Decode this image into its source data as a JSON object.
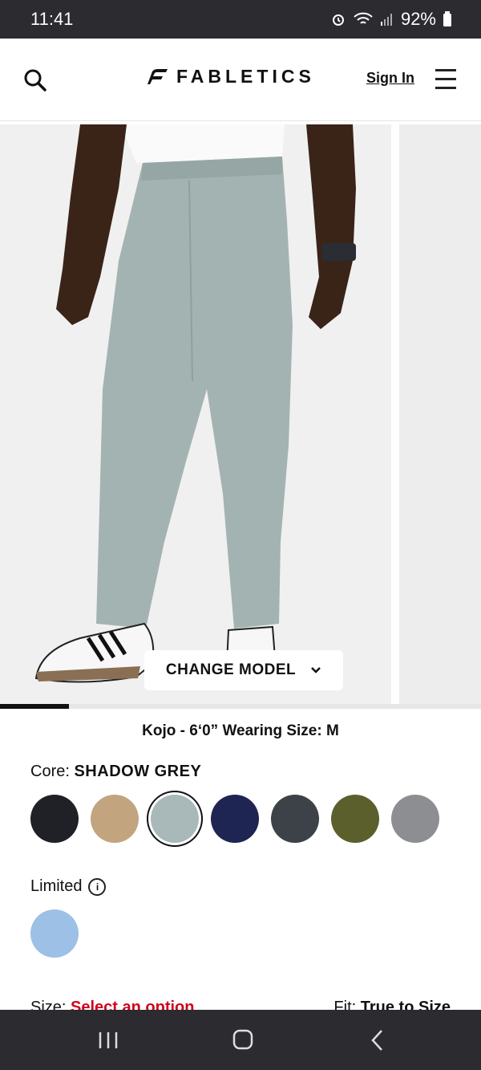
{
  "status_bar": {
    "time": "11:41",
    "battery": "92%"
  },
  "header": {
    "brand": "FABLETICS",
    "sign_in": "Sign In"
  },
  "gallery": {
    "change_model": "CHANGE MODEL",
    "progress": 0.143
  },
  "model_info": "Kojo - 6‘0” Wearing Size: M",
  "color": {
    "label": "Core:",
    "selected_name": "SHADOW GREY",
    "swatches": [
      {
        "name": "black",
        "color": "#1f2126"
      },
      {
        "name": "khaki",
        "color": "#c2a47f"
      },
      {
        "name": "shadow-grey",
        "color": "#a9b9b9",
        "selected": true
      },
      {
        "name": "navy",
        "color": "#1e2552"
      },
      {
        "name": "charcoal",
        "color": "#3d4248"
      },
      {
        "name": "olive",
        "color": "#5b5f2c"
      },
      {
        "name": "heather-grey",
        "color": "#8d8e92"
      }
    ]
  },
  "limited": {
    "label": "Limited",
    "swatch": {
      "name": "light-blue",
      "color": "#9cc0e6"
    }
  },
  "size": {
    "label": "Size:",
    "placeholder": "Select an option",
    "fit_label": "Fit:",
    "fit_value": "True to Size"
  },
  "icons": {
    "search": "search-icon",
    "menu": "hamburger-menu-icon",
    "info": "info-icon"
  },
  "colors": {
    "accent_red": "#d0021b",
    "system_bar": "#2b2b30"
  }
}
